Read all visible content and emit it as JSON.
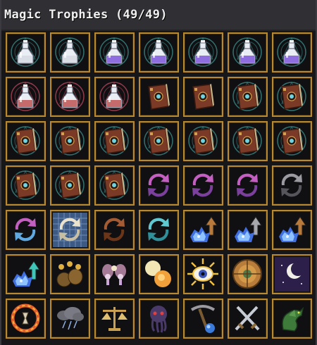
{
  "header": {
    "title": "Magic Trophies (49/49)"
  },
  "colors": {
    "slot_border": "#b8892e",
    "slot_bg": "#101012",
    "header_bg": "#2f2f34"
  },
  "trophies": [
    {
      "icon": "potion-icon",
      "variant": "white"
    },
    {
      "icon": "potion-icon",
      "variant": "white"
    },
    {
      "icon": "potion-icon",
      "variant": "violet"
    },
    {
      "icon": "potion-icon",
      "variant": "violet"
    },
    {
      "icon": "potion-icon",
      "variant": "violet"
    },
    {
      "icon": "potion-icon",
      "variant": "violet"
    },
    {
      "icon": "potion-icon",
      "variant": "violet"
    },
    {
      "icon": "potion-icon",
      "variant": "red"
    },
    {
      "icon": "potion-icon",
      "variant": "red"
    },
    {
      "icon": "potion-icon",
      "variant": "red"
    },
    {
      "icon": "spellbook-icon",
      "variant": "plain"
    },
    {
      "icon": "spellbook-icon",
      "variant": "plain"
    },
    {
      "icon": "spellbook-icon",
      "variant": "circle"
    },
    {
      "icon": "spellbook-icon",
      "variant": "circle"
    },
    {
      "icon": "spellbook-icon",
      "variant": "circle"
    },
    {
      "icon": "spellbook-icon",
      "variant": "circle"
    },
    {
      "icon": "spellbook-icon",
      "variant": "circle"
    },
    {
      "icon": "spellbook-icon",
      "variant": "circle"
    },
    {
      "icon": "spellbook-icon",
      "variant": "circle"
    },
    {
      "icon": "spellbook-icon",
      "variant": "circle"
    },
    {
      "icon": "spellbook-icon",
      "variant": "circle"
    },
    {
      "icon": "spellbook-icon",
      "variant": "circle"
    },
    {
      "icon": "spellbook-icon",
      "variant": "circle"
    },
    {
      "icon": "spellbook-icon",
      "variant": "circle"
    },
    {
      "icon": "cycle-icon",
      "variant": "pink"
    },
    {
      "icon": "cycle-icon",
      "variant": "pink"
    },
    {
      "icon": "cycle-icon",
      "variant": "pink"
    },
    {
      "icon": "cycle-icon",
      "variant": "grey"
    },
    {
      "icon": "cycle-icon",
      "variant": "pinkblue"
    },
    {
      "icon": "cycle-icon",
      "variant": "grid"
    },
    {
      "icon": "cycle-icon",
      "variant": "brown"
    },
    {
      "icon": "cycle-icon",
      "variant": "teal"
    },
    {
      "icon": "crystal-arrow-icon",
      "variant": "brown"
    },
    {
      "icon": "crystal-arrow-icon",
      "variant": "grey"
    },
    {
      "icon": "crystal-arrow-icon",
      "variant": "brown"
    },
    {
      "icon": "crystal-arrow-icon",
      "variant": "teal"
    },
    {
      "icon": "coin-bags-icon",
      "variant": "plain"
    },
    {
      "icon": "fairies-icon",
      "variant": "plain"
    },
    {
      "icon": "moon-sun-icon",
      "variant": "plain"
    },
    {
      "icon": "sun-eye-icon",
      "variant": "plain"
    },
    {
      "icon": "shield-icon",
      "variant": "plain"
    },
    {
      "icon": "moon-night-icon",
      "variant": "plain"
    },
    {
      "icon": "fire-ring-icon",
      "variant": "plain"
    },
    {
      "icon": "storm-cloud-icon",
      "variant": "plain"
    },
    {
      "icon": "scales-icon",
      "variant": "plain"
    },
    {
      "icon": "cthulhu-icon",
      "variant": "plain"
    },
    {
      "icon": "pickaxe-orb-icon",
      "variant": "plain"
    },
    {
      "icon": "crossed-swords-icon",
      "variant": "plain"
    },
    {
      "icon": "dragon-icon",
      "variant": "plain"
    }
  ]
}
